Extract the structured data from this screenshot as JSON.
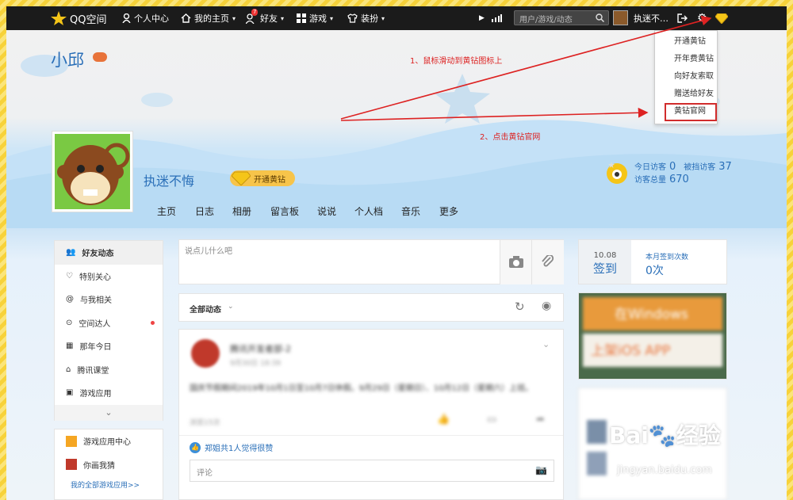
{
  "topbar": {
    "logo": "QQ空间",
    "nav": [
      "个人中心",
      "我的主页",
      "好友",
      "游戏",
      "装扮"
    ],
    "friend_badge": "7",
    "search_placeholder": "用户/游戏/动态",
    "username": "执迷不…"
  },
  "dropdown": {
    "items": [
      "开通黄钻",
      "开年费黄钻",
      "向好友索取",
      "赠送给好友",
      "黄钻官网"
    ]
  },
  "annotations": {
    "step1": "1、鼠标滑动到黄钻图标上",
    "step2": "2、点击黄钻官网"
  },
  "profile": {
    "space_name": "小邱",
    "name": "执迷不悔",
    "open_yellow_diamond": "开通黄钻",
    "tabs": [
      "主页",
      "日志",
      "相册",
      "留言板",
      "说说",
      "个人档",
      "音乐",
      "更多"
    ],
    "today_visits_label": "今日访客",
    "today_visits": "0",
    "blocked_label": "被挡访客",
    "blocked": "37",
    "total_label": "访客总量",
    "total": "670"
  },
  "sidebar": {
    "items": [
      "好友动态",
      "特别关心",
      "与我相关",
      "空间达人",
      "那年今日",
      "腾讯课堂",
      "游戏应用"
    ],
    "apps": [
      "游戏应用中心",
      "你画我猜"
    ],
    "more_apps": "我的全部游戏应用>>"
  },
  "post_box": {
    "placeholder": "说点儿什么吧"
  },
  "feed": {
    "filter": "全部动态",
    "post_author": "腾讯开发者部-2",
    "post_time": "9月30日 18:39",
    "post_text": "国庆节假期间2019年10月1日至10月7日休假。9月29日（星期日）、10月12日（星期六）上班。",
    "post_meta": "浏览15次",
    "likes": "郑姐共1人觉得很赞",
    "comment_placeholder": "评论"
  },
  "signin": {
    "date": "10.08",
    "label": "签到",
    "month_label": "本月签到次数",
    "month_count": "0次"
  },
  "ads": {
    "banner1": "在Windows",
    "banner2": "上架iOS APP"
  },
  "watermark": {
    "site": "jingyan.baidu.com"
  }
}
